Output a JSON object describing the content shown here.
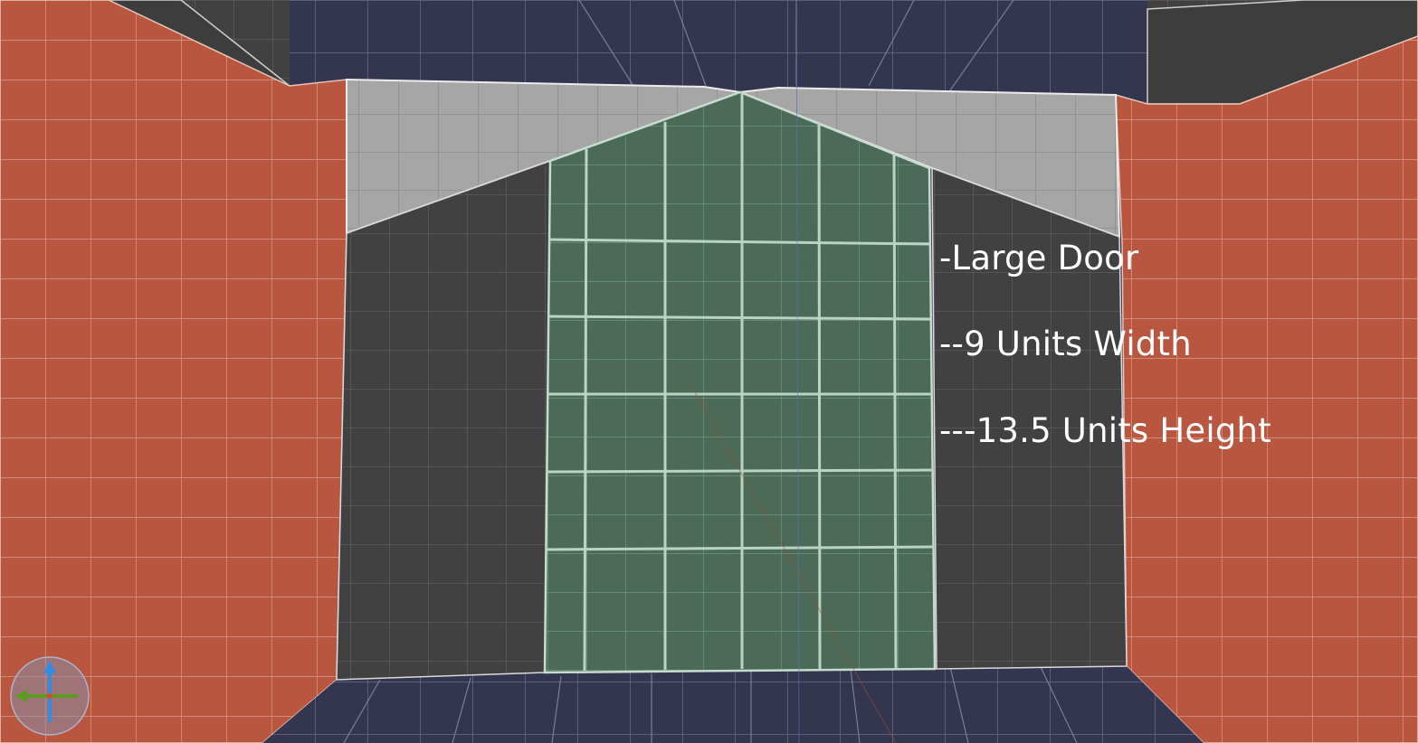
{
  "viewport": {
    "annotations": [
      "-Large Door",
      "--9 Units Width",
      "---13.5 Units Height"
    ]
  },
  "colors": {
    "floor_ceiling": "#34354f",
    "side_walls": "#b95640",
    "back_wall": "#414141",
    "upper_wall": "#a6a6a6",
    "door_panel": "#4b6a58",
    "grid_line": "#ffffff",
    "gizmo_y_axis": "#2f8de4",
    "gizmo_x_axis": "#5c9a21"
  },
  "gizmo": {
    "icon": "axis-gizmo-icon",
    "axes": [
      "y-axis-arrow",
      "x-axis-arrow"
    ]
  }
}
